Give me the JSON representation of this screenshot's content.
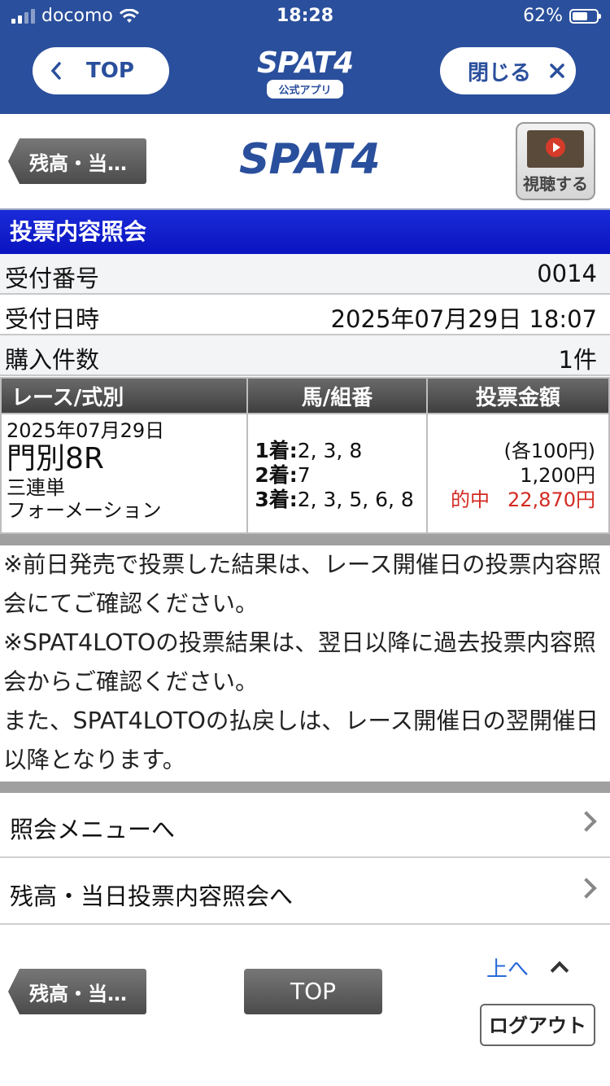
{
  "status_bar": {
    "carrier": "docomo",
    "time": "18:28",
    "battery": "62%"
  },
  "app_header": {
    "top_label": "TOP",
    "close_label": "閉じる",
    "brand": "SPAT4",
    "brand_sub": "公式アプリ"
  },
  "page_header": {
    "back_label": "残高・当…",
    "logo": "SPAT4",
    "watch_label": "視聴する"
  },
  "section_title": "投票内容照会",
  "info": [
    {
      "label": "受付番号",
      "value": "0014"
    },
    {
      "label": "受付日時",
      "value": "2025年07月29日 18:07"
    },
    {
      "label": "購入件数",
      "value": "1件"
    }
  ],
  "table": {
    "headers": [
      "レース/式別",
      "馬/組番",
      "投票金額"
    ],
    "row": {
      "date": "2025年07月29日",
      "track": "門別8R",
      "bet_type": "三連単",
      "method": "フォーメーション",
      "picks": [
        {
          "pos": "1着:",
          "nums": "2, 3, 8"
        },
        {
          "pos": "2着:",
          "nums": "7"
        },
        {
          "pos": "3着:",
          "nums": "2, 3, 5, 6, 8"
        }
      ],
      "each": "(各100円)",
      "total": "1,200円",
      "hit_label": "的中",
      "hit_amount": "22,870円"
    }
  },
  "notes": [
    "※前日発売で投票した結果は、レース開催日の投票内容照会にてご確認ください。",
    "※SPAT4LOTOの投票結果は、翌日以降に過去投票内容照会からご確認ください。",
    "また、SPAT4LOTOの払戻しは、レース開催日の翌開催日以降となります。"
  ],
  "menu": [
    {
      "label": "照会メニューへ"
    },
    {
      "label": "残高・当日投票内容照会へ"
    }
  ],
  "footer": {
    "back_label": "残高・当…",
    "top_label": "TOP",
    "up_label": "上へ",
    "logout_label": "ログアウト"
  }
}
